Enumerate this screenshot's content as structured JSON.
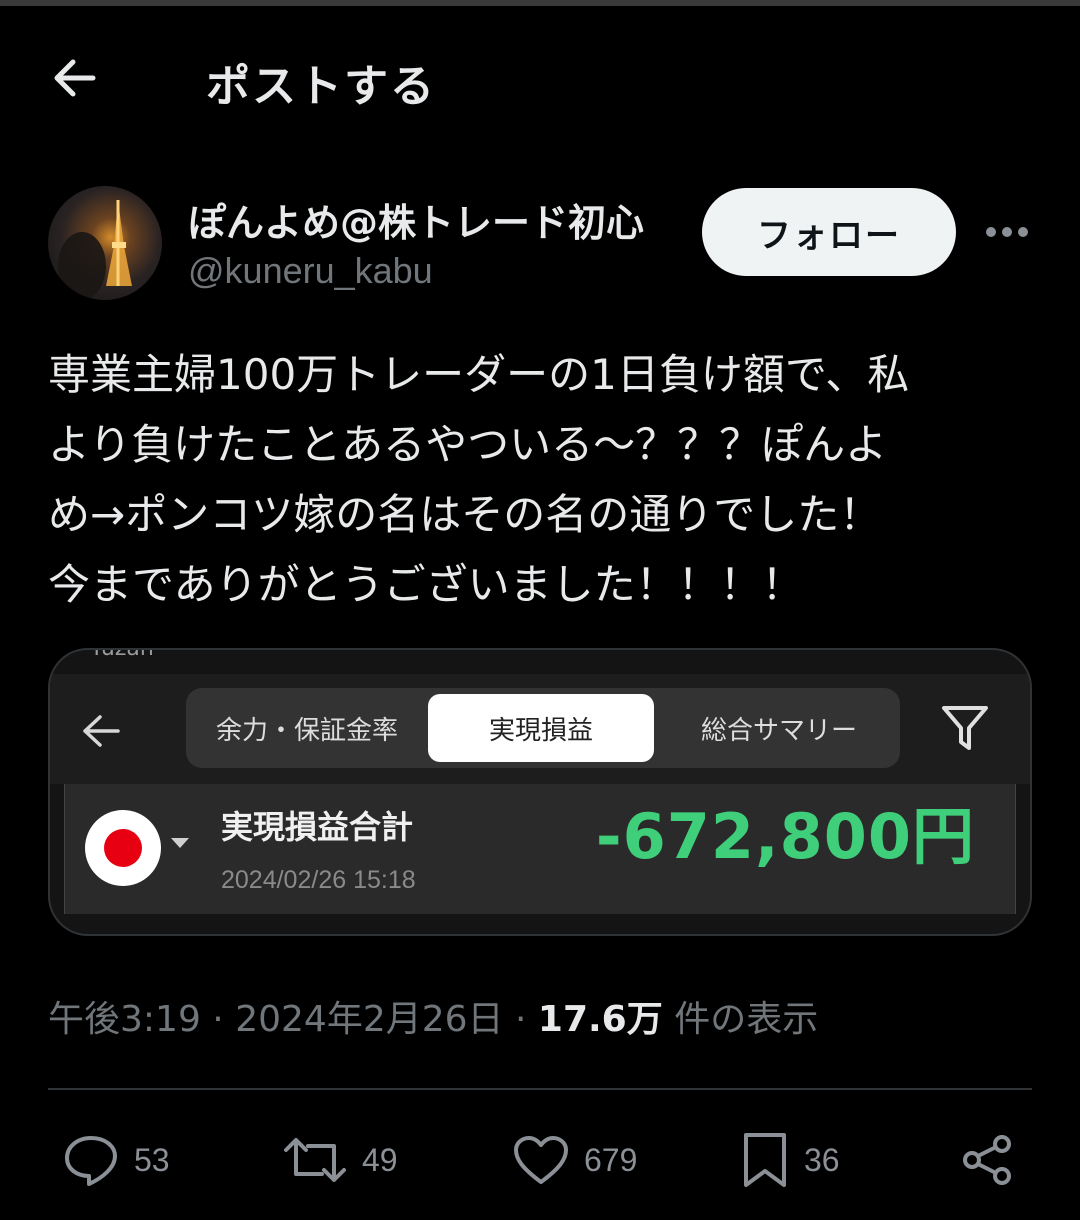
{
  "header": {
    "title": "ポストする",
    "back_icon": "arrow-left-icon"
  },
  "author": {
    "display_name": "ぽんよめ@株トレード初心",
    "handle": "@kuneru_kabu",
    "follow_label": "フォロー",
    "more_icon": "more-dots-icon"
  },
  "post": {
    "lines": [
      "専業主婦100万トレーダーの1日負け額で、私",
      "より負けたことあるやついる〜？？？ぽんよ",
      "め→ポンコツ嫁の名はその名の通りでした！",
      "今までありがとうございました！！！！"
    ]
  },
  "media": {
    "top_partial_text": "Yuzan",
    "tabs": [
      "余力・保証金率",
      "実現損益",
      "総合サマリー"
    ],
    "active_tab": "実現損益",
    "pl_label": "実現損益合計",
    "pl_amount": "-672,800円",
    "pl_date": "2024/02/26 15:18",
    "amount_color": "#3fcf7a"
  },
  "meta": {
    "time": "午後3:19",
    "date": "2024年2月26日",
    "views_count": "17.6万",
    "views_label": "件の表示",
    "separator": "·"
  },
  "actions": {
    "replies": "53",
    "reposts": "49",
    "likes": "679",
    "bookmarks": "36"
  },
  "colors": {
    "background": "#000000",
    "text": "#e7e9ea",
    "muted": "#71767b",
    "follow_bg": "#eff3f4"
  }
}
